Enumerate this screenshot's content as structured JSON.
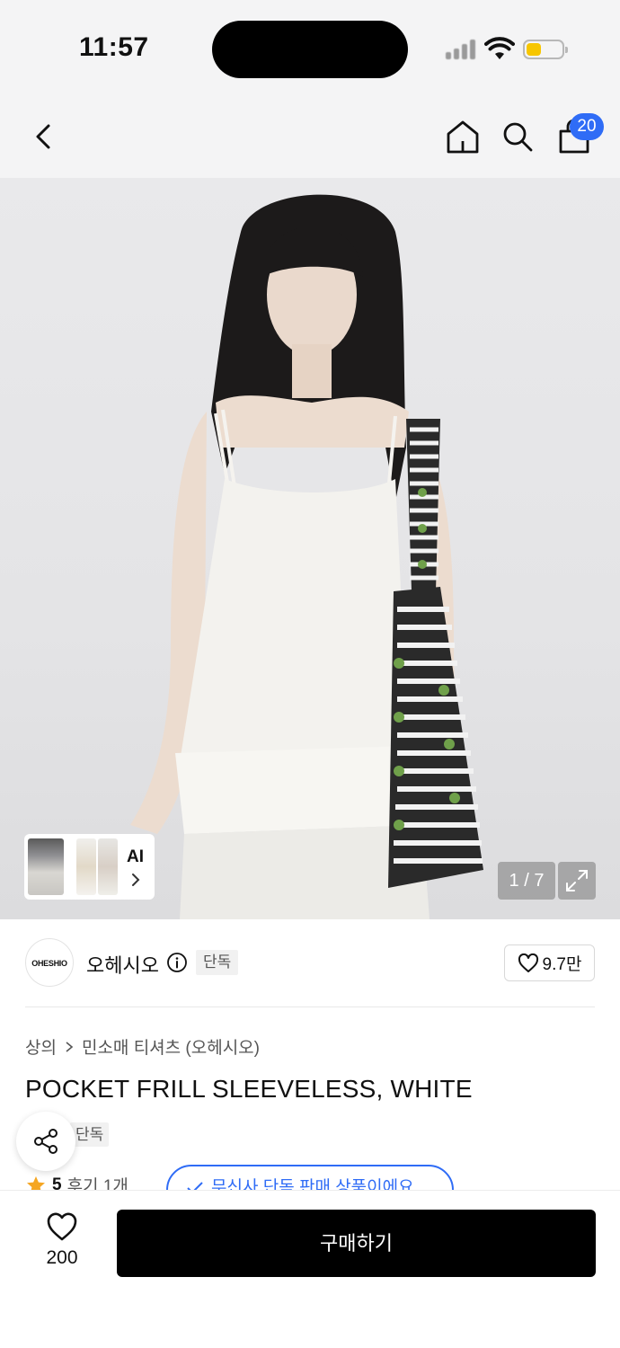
{
  "status_bar": {
    "time": "11:57"
  },
  "header": {
    "cart_count": "20"
  },
  "gallery": {
    "ai_label": "AI",
    "counter": "1 / 7"
  },
  "brand": {
    "logo_text": "OHESHIO",
    "name": "오헤시오",
    "badge": "단독",
    "likes": "9.7만"
  },
  "product": {
    "breadcrumb": [
      "상의",
      "민소매 티셔츠 (오헤시오)"
    ],
    "title": "POCKET FRILL SLEEVELESS, WHITE",
    "tag": "단독",
    "rating_score": "5",
    "review_text": "후기 1개",
    "promo_text": "무신사 단독 판매 상품이에요"
  },
  "bottom": {
    "wish_count": "200",
    "buy_label": "구매하기"
  },
  "colors": {
    "accent": "#2f6cf6",
    "buy_button": "#000000",
    "star": "#f5a623"
  }
}
